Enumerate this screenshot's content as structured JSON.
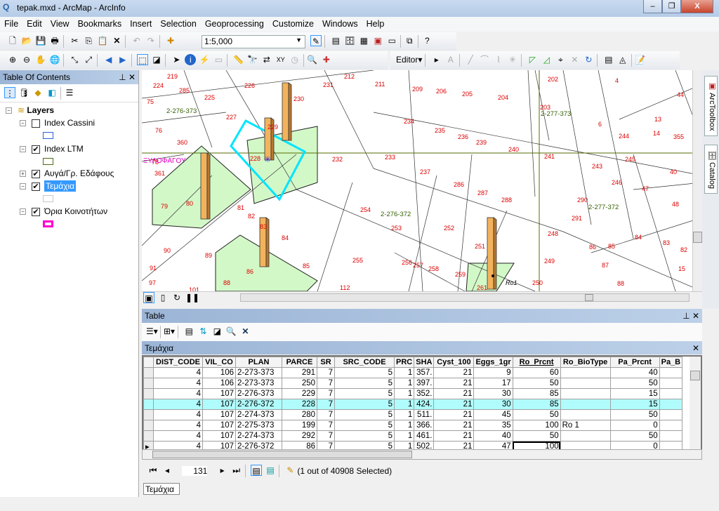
{
  "window": {
    "title": "tepak.mxd - ArcMap - ArcInfo",
    "minimize": "–",
    "restore": "❐",
    "close": "X"
  },
  "menu": [
    "File",
    "Edit",
    "View",
    "Bookmarks",
    "Insert",
    "Selection",
    "Geoprocessing",
    "Customize",
    "Windows",
    "Help"
  ],
  "toolbar": {
    "scale": "1:5,000",
    "editor": "Editor▾"
  },
  "toc": {
    "title": "Table Of Contents",
    "root": "Layers",
    "layers": [
      {
        "name": "Index Cassini",
        "checked": false,
        "expanded": true,
        "color": "#2b63d6"
      },
      {
        "name": "Index LTM",
        "checked": true,
        "expanded": true,
        "color": "#4f6b12"
      },
      {
        "name": "Αυγά/Γρ. Εδάφους",
        "checked": true,
        "expanded": false
      },
      {
        "name": "Τεμάχια",
        "checked": true,
        "expanded": true,
        "selected": true,
        "color": "#c8c8c8"
      },
      {
        "name": "Όρια Κοινοτήτων",
        "checked": true,
        "expanded": true,
        "color": "#ff00cc"
      }
    ]
  },
  "dock": {
    "arctoolbox": "ArcToolbox",
    "catalog": "Catalog"
  },
  "map": {
    "parcel_labels": [
      "219",
      "224",
      "285",
      "225",
      "226",
      "230",
      "231",
      "212",
      "211",
      "209",
      "206",
      "205",
      "204",
      "202",
      "203",
      "4",
      "75",
      "227",
      "229",
      "234",
      "235",
      "236",
      "239",
      "240",
      "6",
      "244",
      "76",
      "360",
      "228",
      "233",
      "232",
      "241",
      "243",
      "245",
      "237",
      "286",
      "287",
      "288",
      "246",
      "47",
      "78",
      "361",
      "79",
      "80",
      "81",
      "82",
      "83",
      "84",
      "254",
      "253",
      "252",
      "290",
      "291",
      "248",
      "48",
      "90",
      "89",
      "85",
      "86",
      "255",
      "256",
      "257",
      "258",
      "259",
      "251",
      "249",
      "86",
      "85",
      "84",
      "83",
      "82",
      "15",
      "88",
      "91",
      "97",
      "101",
      "88",
      "112",
      "261",
      "250",
      "87",
      "13",
      "14",
      "355",
      "44",
      "40"
    ],
    "plan_labels": [
      "2-276-373",
      "2-277-373",
      "2-276-372",
      "2-277-372"
    ],
    "place_label": "ΞΥΛΟΦΑΓΟΥ",
    "point_label": "Ro1"
  },
  "table": {
    "pane_title": "Table",
    "layer_title": "Τεμάχια",
    "columns": [
      "DIST_CODE",
      "VIL_CO",
      "PLAN",
      "PARCE",
      "SR",
      "SRC_CODE",
      "PRC",
      "SHA",
      "Cyst_100",
      "Eggs_1gr",
      "Ro_Prcnt",
      "Ro_BioType",
      "Pa_Prcnt",
      "Pa_B"
    ],
    "rows": [
      [
        "4",
        "106",
        "2-273-373",
        "291",
        "7",
        "5",
        "1",
        "357.",
        "21",
        "9",
        "60",
        "",
        "40",
        ""
      ],
      [
        "4",
        "106",
        "2-273-373",
        "250",
        "7",
        "5",
        "1",
        "397.",
        "21",
        "17",
        "50",
        "",
        "50",
        ""
      ],
      [
        "4",
        "107",
        "2-276-373",
        "229",
        "7",
        "5",
        "1",
        "352.",
        "21",
        "30",
        "85",
        "",
        "15",
        ""
      ],
      [
        "4",
        "107",
        "2-276-372",
        "228",
        "7",
        "5",
        "1",
        "424.",
        "21",
        "30",
        "85",
        "",
        "15",
        ""
      ],
      [
        "4",
        "107",
        "2-274-373",
        "280",
        "7",
        "5",
        "1",
        "511.",
        "21",
        "45",
        "50",
        "",
        "50",
        ""
      ],
      [
        "4",
        "107",
        "2-275-373",
        "199",
        "7",
        "5",
        "1",
        "366.",
        "21",
        "35",
        "100",
        "Ro 1",
        "0",
        ""
      ],
      [
        "4",
        "107",
        "2-274-373",
        "292",
        "7",
        "5",
        "1",
        "461.",
        "21",
        "40",
        "50",
        "",
        "50",
        ""
      ],
      [
        "4",
        "107",
        "2-276-372",
        "86",
        "7",
        "5",
        "1",
        "502.",
        "21",
        "47",
        "100",
        "",
        "0",
        ""
      ]
    ],
    "selected_row": 3,
    "current_row": 7,
    "record": "131",
    "status": "(1 out of 40908 Selected)",
    "tab": "Τεμάχια"
  }
}
